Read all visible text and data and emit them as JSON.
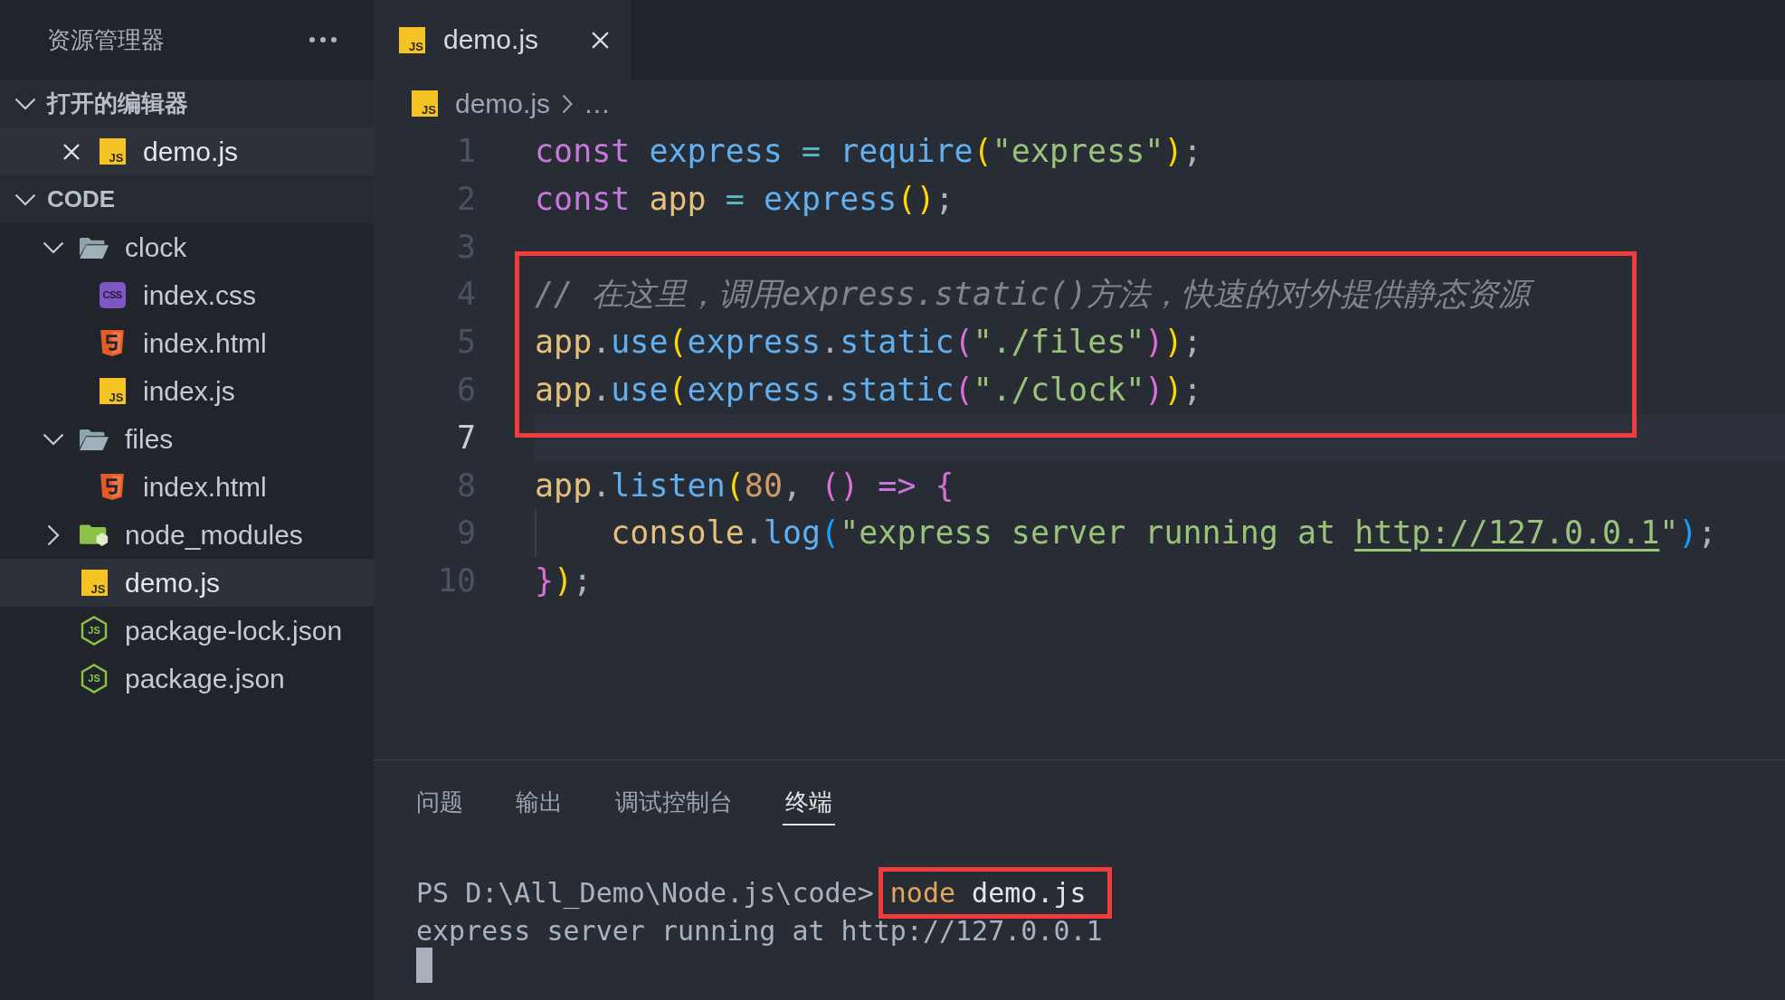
{
  "sidebar": {
    "title": "资源管理器",
    "sections": [
      {
        "title": "打开的编辑器",
        "kind": "open-editors",
        "expanded": true,
        "items": [
          {
            "name": "demo.js",
            "kind": "js",
            "icon_text": "JS",
            "selected": true
          }
        ]
      },
      {
        "title": "CODE",
        "kind": "folder-tree",
        "expanded": true,
        "items": [
          {
            "name": "clock",
            "kind": "folder",
            "expanded": true,
            "selected": false,
            "children": [
              {
                "name": "index.css",
                "kind": "css",
                "icon_text": "CSS",
                "selected": false
              },
              {
                "name": "index.html",
                "kind": "html",
                "selected": false
              },
              {
                "name": "index.js",
                "kind": "js",
                "icon_text": "JS",
                "selected": false
              }
            ]
          },
          {
            "name": "files",
            "kind": "folder",
            "expanded": true,
            "selected": false,
            "children": [
              {
                "name": "index.html",
                "kind": "html",
                "selected": false
              }
            ]
          },
          {
            "name": "node_modules",
            "kind": "modules",
            "expanded": false,
            "selected": false
          },
          {
            "name": "demo.js",
            "kind": "js",
            "icon_text": "JS",
            "selected": true
          },
          {
            "name": "package-lock.json",
            "kind": "json",
            "icon_text": "JS",
            "selected": false
          },
          {
            "name": "package.json",
            "kind": "json",
            "icon_text": "JS",
            "selected": false
          }
        ]
      }
    ]
  },
  "editor": {
    "tabs": [
      {
        "label": "demo.js",
        "kind": "js",
        "icon_text": "JS",
        "selected": true
      }
    ],
    "breadcrumb": [
      {
        "label": "demo.js",
        "kind": "js",
        "icon_text": "JS"
      },
      {
        "label": "…",
        "kind": "more"
      }
    ],
    "lines": [
      {
        "number": "1",
        "current": false,
        "annotated": false,
        "indent_guide": false,
        "tokens": [
          {
            "kind": "keyword",
            "text": "const "
          },
          {
            "kind": "var",
            "text": "express "
          },
          {
            "kind": "op",
            "text": "= "
          },
          {
            "kind": "func",
            "text": "require"
          },
          {
            "kind": "paren1",
            "text": "("
          },
          {
            "kind": "str",
            "text": "\"express\""
          },
          {
            "kind": "paren1",
            "text": ")"
          },
          {
            "kind": "punct",
            "text": ";"
          }
        ]
      },
      {
        "number": "2",
        "current": false,
        "annotated": false,
        "indent_guide": false,
        "tokens": [
          {
            "kind": "keyword",
            "text": "const "
          },
          {
            "kind": "obj",
            "text": "app "
          },
          {
            "kind": "op",
            "text": "= "
          },
          {
            "kind": "func",
            "text": "express"
          },
          {
            "kind": "paren1",
            "text": "("
          },
          {
            "kind": "paren1",
            "text": ")"
          },
          {
            "kind": "punct",
            "text": ";"
          }
        ]
      },
      {
        "number": "3",
        "current": false,
        "annotated": false,
        "indent_guide": false
      },
      {
        "number": "4",
        "current": false,
        "annotated": true,
        "indent_guide": false,
        "tokens": [
          {
            "kind": "comment",
            "text": "// 在这里，调用express.static()方法，快速的对外提供静态资源"
          }
        ]
      },
      {
        "number": "5",
        "current": false,
        "annotated": true,
        "indent_guide": false,
        "tokens": [
          {
            "kind": "obj",
            "text": "app"
          },
          {
            "kind": "punct",
            "text": "."
          },
          {
            "kind": "func",
            "text": "use"
          },
          {
            "kind": "paren1",
            "text": "("
          },
          {
            "kind": "var",
            "text": "express"
          },
          {
            "kind": "punct",
            "text": "."
          },
          {
            "kind": "func",
            "text": "static"
          },
          {
            "kind": "paren2",
            "text": "("
          },
          {
            "kind": "str",
            "text": "\"./files\""
          },
          {
            "kind": "paren2",
            "text": ")"
          },
          {
            "kind": "paren1",
            "text": ")"
          },
          {
            "kind": "punct",
            "text": ";"
          }
        ]
      },
      {
        "number": "6",
        "current": false,
        "annotated": true,
        "indent_guide": false,
        "tokens": [
          {
            "kind": "obj",
            "text": "app"
          },
          {
            "kind": "punct",
            "text": "."
          },
          {
            "kind": "func",
            "text": "use"
          },
          {
            "kind": "paren1",
            "text": "("
          },
          {
            "kind": "var",
            "text": "express"
          },
          {
            "kind": "punct",
            "text": "."
          },
          {
            "kind": "func",
            "text": "static"
          },
          {
            "kind": "paren2",
            "text": "("
          },
          {
            "kind": "str",
            "text": "\"./clock\""
          },
          {
            "kind": "paren2",
            "text": ")"
          },
          {
            "kind": "paren1",
            "text": ")"
          },
          {
            "kind": "punct",
            "text": ";"
          }
        ]
      },
      {
        "number": "7",
        "current": true,
        "annotated": false,
        "indent_guide": false
      },
      {
        "number": "8",
        "current": false,
        "annotated": false,
        "indent_guide": false,
        "tokens": [
          {
            "kind": "obj",
            "text": "app"
          },
          {
            "kind": "punct",
            "text": "."
          },
          {
            "kind": "func",
            "text": "listen"
          },
          {
            "kind": "paren1",
            "text": "("
          },
          {
            "kind": "num",
            "text": "80"
          },
          {
            "kind": "punct",
            "text": ", "
          },
          {
            "kind": "paren2",
            "text": "("
          },
          {
            "kind": "paren2",
            "text": ") "
          },
          {
            "kind": "keyword",
            "text": "=> "
          },
          {
            "kind": "paren2",
            "text": "{"
          }
        ]
      },
      {
        "number": "9",
        "current": false,
        "annotated": false,
        "indent_guide": true,
        "tokens": [
          {
            "kind": "obj",
            "text": "console"
          },
          {
            "kind": "punct",
            "text": "."
          },
          {
            "kind": "func",
            "text": "log"
          },
          {
            "kind": "paren3",
            "text": "("
          },
          {
            "kind": "str",
            "text": "\"express server running at "
          },
          {
            "kind": "url",
            "text": "http://127.0.0.1"
          },
          {
            "kind": "str",
            "text": "\""
          },
          {
            "kind": "paren3",
            "text": ")"
          },
          {
            "kind": "punct",
            "text": ";"
          }
        ]
      },
      {
        "number": "10",
        "current": false,
        "annotated": false,
        "indent_guide": false,
        "tokens": [
          {
            "kind": "paren2",
            "text": "}"
          },
          {
            "kind": "paren1",
            "text": ")"
          },
          {
            "kind": "punct",
            "text": ";"
          }
        ]
      }
    ]
  },
  "panel": {
    "tabs": [
      {
        "label": "问题",
        "selected": false
      },
      {
        "label": "输出",
        "selected": false
      },
      {
        "label": "调试控制台",
        "selected": false
      },
      {
        "label": "终端",
        "selected": true
      }
    ],
    "terminal": {
      "lines": [
        {
          "kind": "command",
          "prompt": "PS D:\\All_Demo\\Node.js\\code>",
          "command": "node",
          "argument": "demo.js",
          "annotated": true
        },
        {
          "kind": "output",
          "text": "express server running at http://127.0.0.1",
          "annotated": false
        }
      ]
    }
  }
}
